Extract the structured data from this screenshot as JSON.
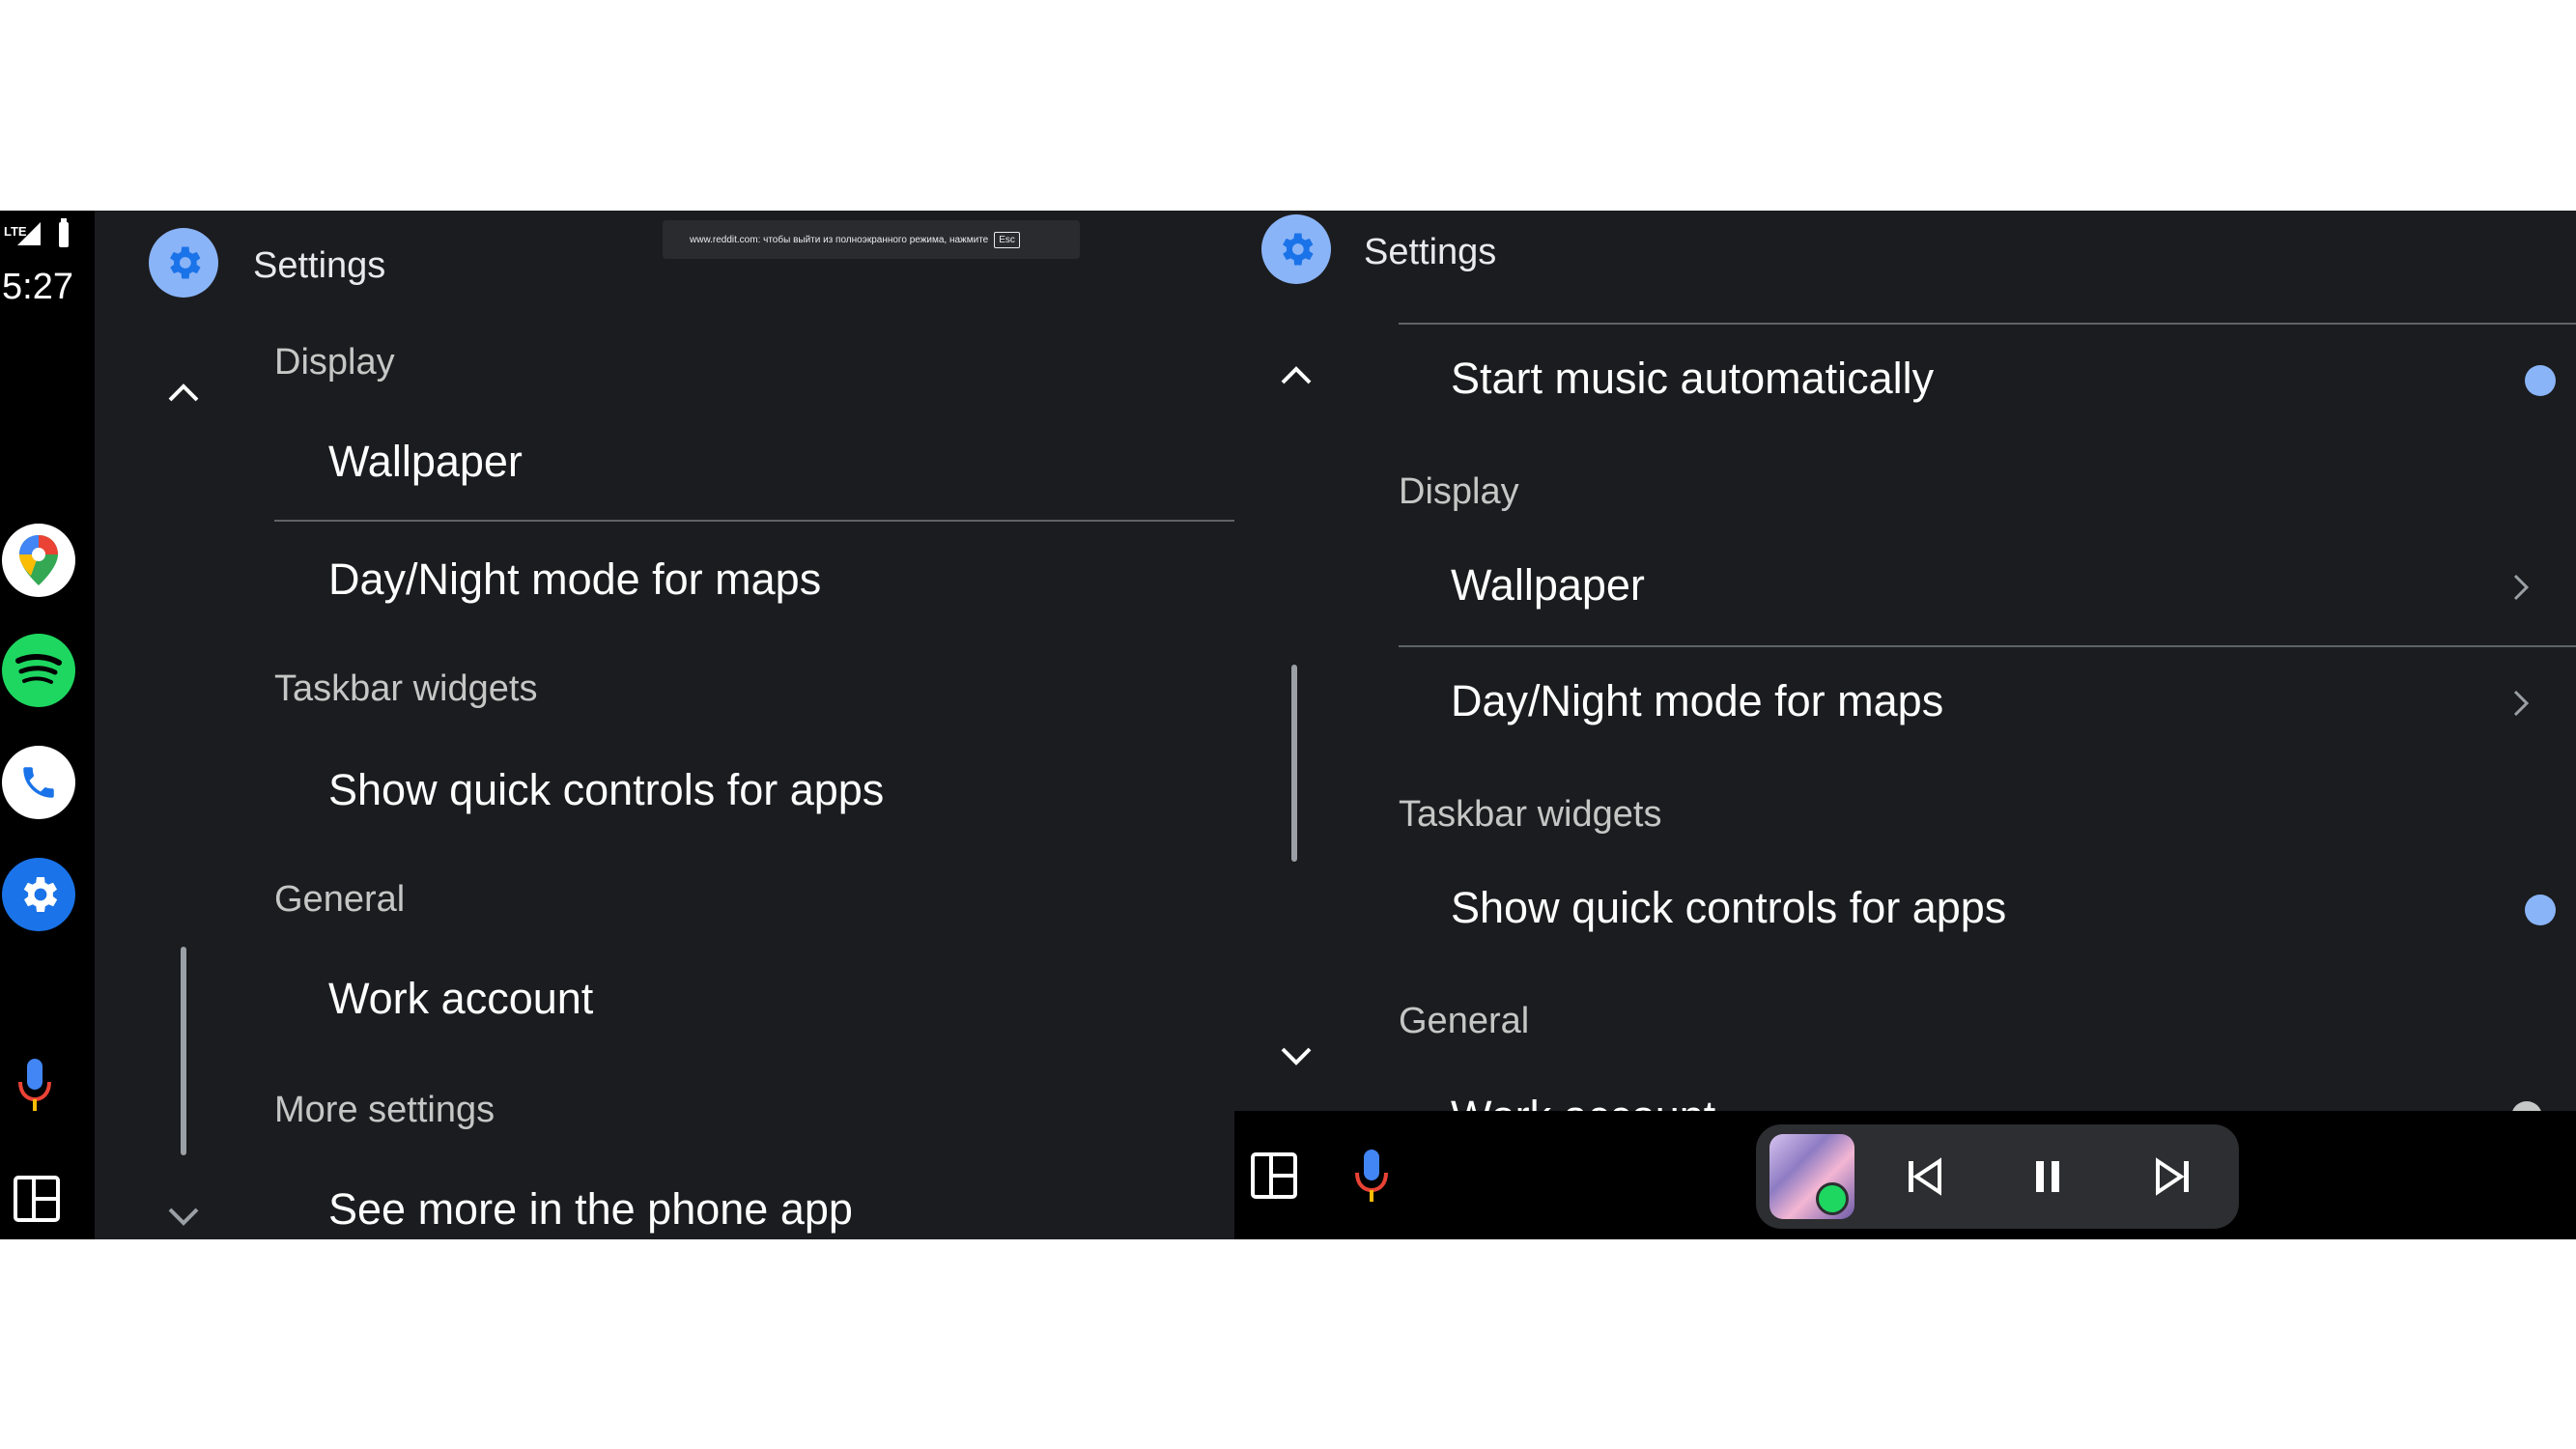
{
  "status_bar": {
    "network": "LTE",
    "time": "5:27"
  },
  "rail": {
    "apps": [
      {
        "name": "Google Maps",
        "icon": "maps-icon"
      },
      {
        "name": "Spotify",
        "icon": "spotify-icon"
      },
      {
        "name": "Phone",
        "icon": "phone-icon"
      },
      {
        "name": "Settings",
        "icon": "settings-icon"
      }
    ]
  },
  "fullscreen_banner": {
    "text": "www.reddit.com: чтобы выйти из полноэкранного режима, нажмите",
    "key": "Esc"
  },
  "left_panel": {
    "title": "Settings",
    "sections": {
      "display": "Display",
      "taskbar_widgets": "Taskbar widgets",
      "general": "General",
      "more_settings": "More settings"
    },
    "items": {
      "wallpaper": "Wallpaper",
      "day_night": "Day/Night mode for maps",
      "quick_controls": "Show quick controls for apps",
      "work_account": "Work account",
      "see_more": "See more in the phone app"
    }
  },
  "right_panel": {
    "title": "Settings",
    "items": {
      "start_music": "Start music automatically",
      "display": "Display",
      "wallpaper": "Wallpaper",
      "day_night": "Day/Night mode for maps",
      "taskbar_widgets": "Taskbar widgets",
      "quick_controls": "Show quick controls for apps",
      "general": "General",
      "work_account": "Work account"
    },
    "toggles": {
      "start_music": true,
      "quick_controls": true
    }
  },
  "taskbar": {
    "media": {
      "source": "Spotify"
    }
  },
  "colors": {
    "accent": "#8ab4f8",
    "background": "#1b1c1f",
    "rail": "#000000"
  }
}
